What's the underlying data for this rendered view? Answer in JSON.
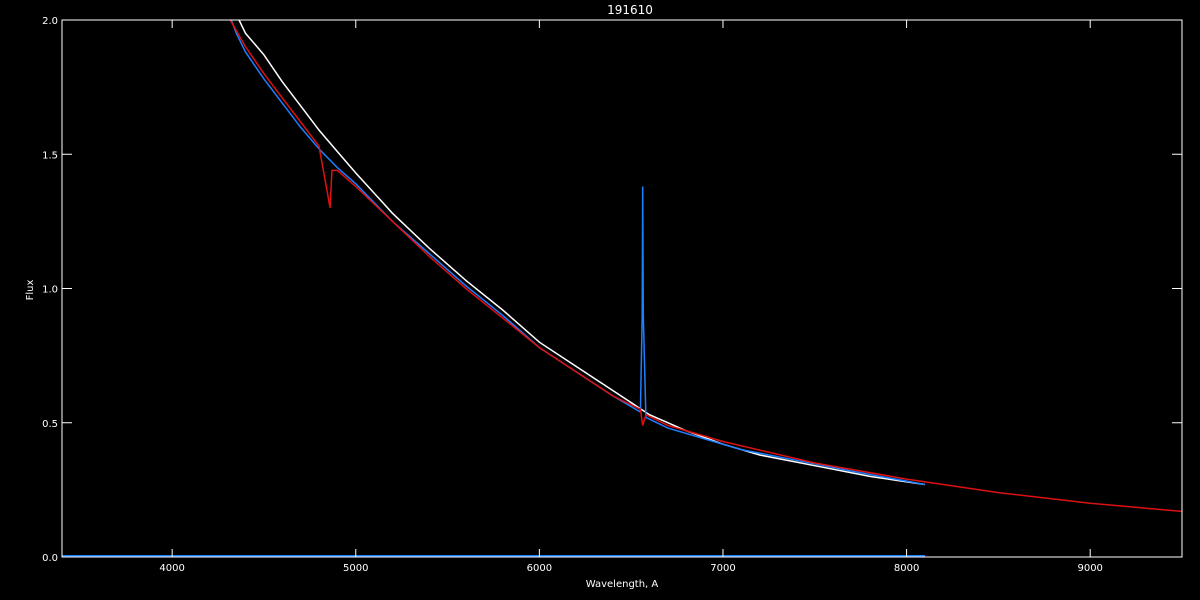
{
  "chart_data": {
    "type": "line",
    "title": "191610",
    "xlabel": "Wavelength, A",
    "ylabel": "Flux",
    "xlim": [
      3400,
      9500
    ],
    "ylim": [
      0.0,
      2.0
    ],
    "xticks": [
      4000,
      5000,
      6000,
      7000,
      8000,
      9000
    ],
    "yticks": [
      0.0,
      0.5,
      1.0,
      1.5,
      2.0
    ],
    "ytick_labels": [
      "0.0",
      "0.5",
      "1.0",
      "1.5",
      "2.0"
    ],
    "grid": false,
    "series": [
      {
        "color": "#ffffff",
        "x": [
          3400,
          3800,
          4100,
          4300,
          4350,
          4400,
          4500,
          4600,
          4700,
          4800,
          4900,
          5000,
          5200,
          5400,
          5600,
          5800,
          6000,
          6200,
          6400,
          6600,
          6800,
          7000,
          7200,
          7500,
          7800,
          8100
        ],
        "y": [
          2.1,
          2.1,
          2.08,
          2.05,
          2.02,
          1.95,
          1.87,
          1.77,
          1.68,
          1.59,
          1.51,
          1.43,
          1.28,
          1.15,
          1.03,
          0.92,
          0.8,
          0.71,
          0.62,
          0.53,
          0.47,
          0.42,
          0.38,
          0.34,
          0.3,
          0.27
        ]
      },
      {
        "color": "#1e7fff",
        "x": [
          3400,
          3800,
          4100,
          4300,
          4350,
          4400,
          4500,
          4600,
          4700,
          4800,
          4900,
          5000,
          5200,
          5400,
          5600,
          5800,
          6000,
          6200,
          6400,
          6550,
          6560,
          6563,
          6566,
          6580,
          6700,
          6900,
          7100,
          7400,
          7700,
          8100
        ],
        "y": [
          2.15,
          2.12,
          2.08,
          2.04,
          1.95,
          1.88,
          1.78,
          1.69,
          1.6,
          1.52,
          1.45,
          1.39,
          1.25,
          1.13,
          1.01,
          0.9,
          0.78,
          0.69,
          0.6,
          0.54,
          0.9,
          1.38,
          0.9,
          0.52,
          0.48,
          0.44,
          0.4,
          0.36,
          0.32,
          0.27
        ]
      },
      {
        "color": "#dd1111",
        "x": [
          4300,
          4400,
          4500,
          4600,
          4700,
          4800,
          4860,
          4870,
          4900,
          5000,
          5200,
          5400,
          5600,
          5800,
          6000,
          6200,
          6400,
          6550,
          6563,
          6580,
          6700,
          7000,
          7500,
          8000,
          8500,
          9000,
          9500
        ],
        "y": [
          2.02,
          1.9,
          1.8,
          1.71,
          1.62,
          1.53,
          1.3,
          1.44,
          1.44,
          1.38,
          1.25,
          1.12,
          1.0,
          0.89,
          0.78,
          0.69,
          0.6,
          0.55,
          0.49,
          0.53,
          0.49,
          0.43,
          0.35,
          0.29,
          0.24,
          0.2,
          0.17
        ]
      },
      {
        "color": "#1e7fff",
        "x": [
          3400,
          8100
        ],
        "y": [
          0.005,
          0.005
        ]
      }
    ]
  }
}
